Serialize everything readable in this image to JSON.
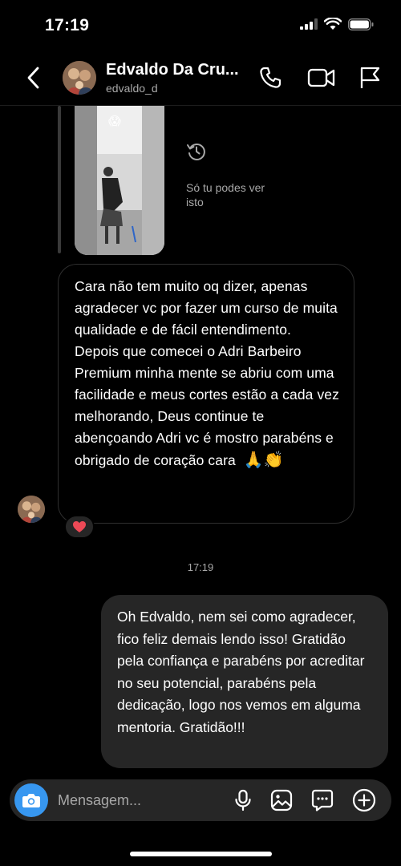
{
  "status_bar": {
    "time": "17:19"
  },
  "header": {
    "contact_name": "Edvaldo Da Cru...",
    "username": "edvaldo_d"
  },
  "story_reply": {
    "thumb_emoji": "😱",
    "note": "Só tu podes ver isto"
  },
  "messages": {
    "incoming": {
      "text": "Cara não tem muito oq dizer, apenas agradecer vc por fazer um curso de muita qualidade e de fácil entendimento. Depois que comecei o Adri Barbeiro Premium minha mente se abriu com uma facilidade e meus cortes estão a cada vez melhorando, Deus continue te abençoando Adri vc é mostro parabéns e obrigado de coração cara",
      "emojis": "🙏👏",
      "reaction": "❤️"
    },
    "timestamp": "17:19",
    "outgoing": {
      "text": "Oh Edvaldo, nem sei como agradecer, fico feliz demais lendo isso! Gratidão pela confiança e parabéns por acreditar no seu potencial, parabéns pela dedicação, logo nos vemos em alguma mentoria. Gratidão!!!"
    }
  },
  "composer": {
    "placeholder": "Mensagem..."
  },
  "colors": {
    "background": "#000000",
    "outgoing_bubble": "#262626",
    "incoming_border": "#2f2f2f",
    "camera_button": "#3797f0",
    "secondary_text": "#a8a8a8",
    "reaction_heart": "#ed4956"
  },
  "icons": {
    "status": [
      "signal-icon",
      "wifi-icon",
      "battery-icon"
    ],
    "header": [
      "back-icon",
      "phone-icon",
      "video-icon",
      "flag-icon"
    ],
    "composer": [
      "camera-icon",
      "microphone-icon",
      "gallery-icon",
      "sticker-icon",
      "plus-icon"
    ]
  }
}
